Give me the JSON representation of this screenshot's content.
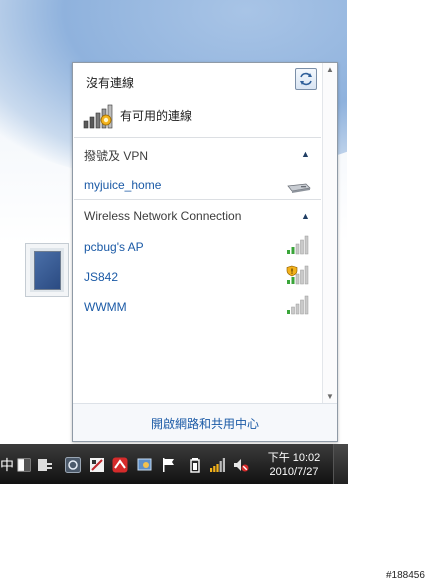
{
  "flyout": {
    "status_title": "沒有連線",
    "availability_text": "有可用的連線",
    "dialup_section": {
      "title": "撥號及 VPN",
      "connections": [
        {
          "name": "myjuice_home",
          "icon": "modem-icon"
        }
      ]
    },
    "wireless_section": {
      "title": "Wireless Network Connection",
      "networks": [
        {
          "name": "pcbug's AP",
          "icon": "signal-icon",
          "signal_bars": 5,
          "secured": false
        },
        {
          "name": "JS842",
          "icon": "signal-shield-icon",
          "signal_bars": 5,
          "secured": true
        },
        {
          "name": "WWMM",
          "icon": "signal-icon",
          "signal_bars": 5,
          "secured": false
        }
      ]
    },
    "footer_link": "開啟網路和共用中心"
  },
  "taskbar": {
    "ime_label": "中",
    "clock_time": "下午 10:02",
    "clock_date": "2010/7/27",
    "tray_icons": [
      "input-mode-icon",
      "keyboard-icon",
      "sync-icon",
      "app-icon",
      "antivirus-icon",
      "messenger-icon",
      "action-center-flag-icon",
      "battery-icon",
      "network-icon",
      "volume-muted-icon"
    ]
  },
  "watermark": "#188456",
  "colors": {
    "link": "#1b5aa6",
    "taskbar": "#1a1a1a",
    "warning": "#f3b21b"
  }
}
